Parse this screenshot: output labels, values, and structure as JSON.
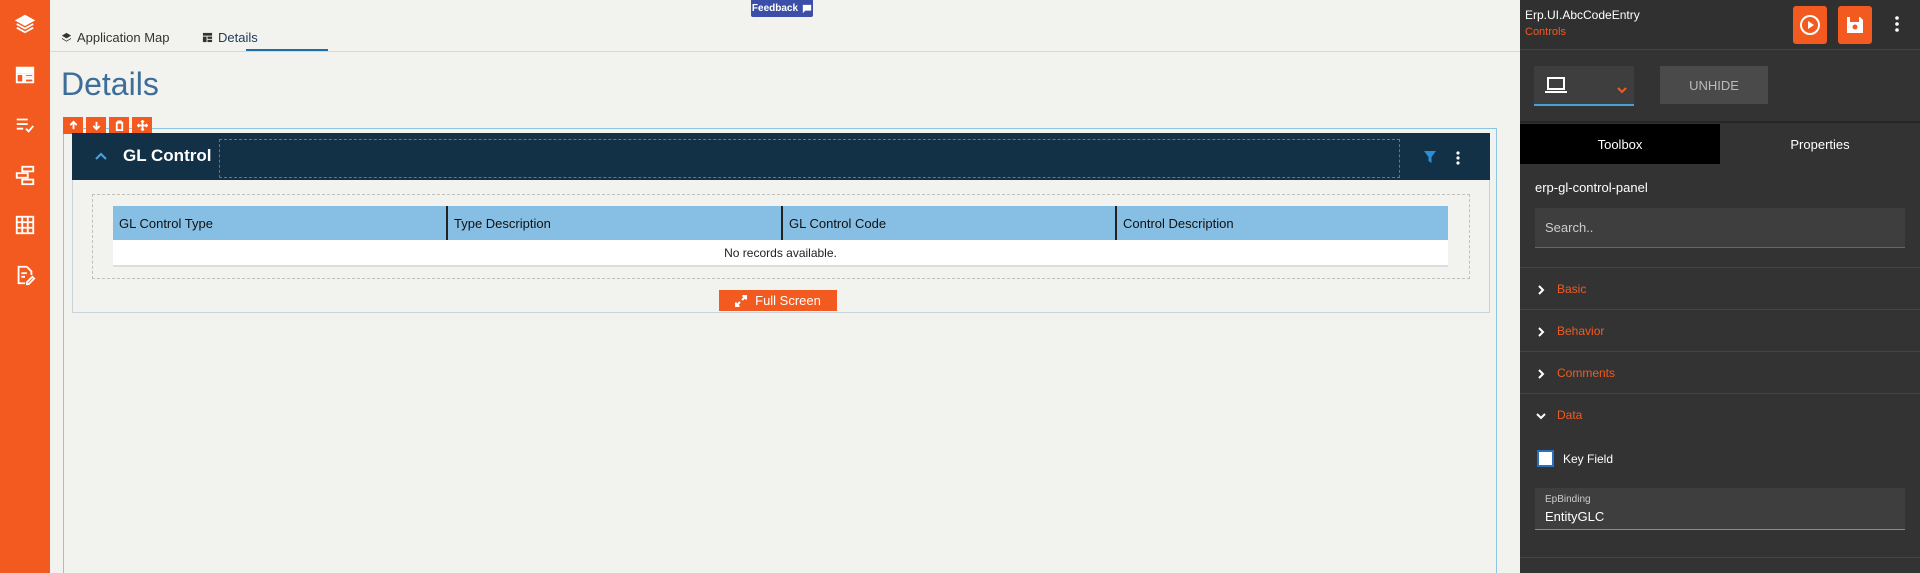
{
  "tabs": [
    {
      "label": "Application Map",
      "icon": "layers-icon"
    },
    {
      "label": "Details",
      "icon": "table-icon",
      "active": true
    }
  ],
  "feedback": {
    "label": "Feedback"
  },
  "page": {
    "title": "Details"
  },
  "panel": {
    "title": "GL Control"
  },
  "grid": {
    "columns": [
      "GL Control Type",
      "Type Description",
      "GL Control Code",
      "Control Description"
    ],
    "empty_message": "No records available."
  },
  "fullscreen": {
    "label": "Full Screen"
  },
  "sidebar": {
    "app_name": "Erp.UI.AbcCodeEntry",
    "app_sub": "Controls",
    "unhide_label": "UNHIDE",
    "tab_toolbox": "Toolbox",
    "tab_properties": "Properties",
    "component_name": "erp-gl-control-panel",
    "search_placeholder": "Search..",
    "sections": [
      {
        "label": "Basic",
        "expanded": false
      },
      {
        "label": "Behavior",
        "expanded": false
      },
      {
        "label": "Comments",
        "expanded": false
      },
      {
        "label": "Data",
        "expanded": true
      }
    ],
    "key_field_label": "Key Field",
    "ep_binding_label": "EpBinding",
    "ep_binding_value": "EntityGLC"
  },
  "colors": {
    "accent": "#f35a1f",
    "panel_header": "#123046",
    "grid_header": "#86bfe3",
    "sidebar_bg": "#333333",
    "title_blue": "#3d6d9a"
  }
}
